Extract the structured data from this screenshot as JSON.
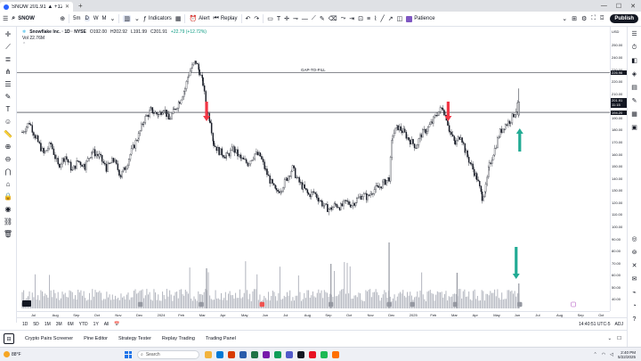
{
  "browser": {
    "tab_title": "SNOW 201.91 ▲ +12.73%",
    "new_tab": "+"
  },
  "toolbar": {
    "symbol": "SNOW",
    "interval_5m": "5m",
    "interval_d": "D",
    "interval_w": "W",
    "interval_m": "M",
    "indicators_label": "Indicators",
    "alert_label": "Alert",
    "replay_label": "Replay",
    "patience_label": "Patience",
    "publish_label": "Publish"
  },
  "legend": {
    "symbol_line": "Snowflake Inc. · 1D · NYSE",
    "o": "O192.00",
    "h": "H202.92",
    "l": "L191.99",
    "c": "C201.91",
    "change": "+22.79 (+12.72%)",
    "vol": "Vol 22.76M"
  },
  "annotations": {
    "gap_label": "GAP-TO-FILL"
  },
  "price_axis": {
    "currency": "USD",
    "ticks": [
      "260.00",
      "250.00",
      "240.00",
      "230.00",
      "220.00",
      "210.00",
      "200.00",
      "190.00",
      "180.00",
      "170.00",
      "160.00",
      "150.00",
      "140.00",
      "130.00",
      "120.00",
      "110.00",
      "100.00",
      "90.00",
      "80.00",
      "70.00",
      "60.00",
      "50.00",
      "40.00"
    ],
    "gap_price": "226.96",
    "current_price": "201.91",
    "current_time": "11:15",
    "support_price": "194.20"
  },
  "time_axis": {
    "labels": [
      "Jul",
      "Aug",
      "Sep",
      "Oct",
      "Nov",
      "Dec",
      "2024",
      "Feb",
      "Mar",
      "Apr",
      "May",
      "Jun",
      "Jul",
      "Aug",
      "Sep",
      "Oct",
      "Nov",
      "Dec",
      "2025",
      "Feb",
      "Mar",
      "Apr",
      "May",
      "Jun",
      "Jul",
      "Aug",
      "Sep",
      "Oct"
    ]
  },
  "rangebar": {
    "ranges": [
      "1D",
      "5D",
      "1M",
      "3M",
      "6M",
      "YTD",
      "1Y",
      "All"
    ],
    "clock": "14:40:51 UTC-5",
    "adj": "ADJ"
  },
  "panels": {
    "tabs": [
      "Crypto Pairs Screener",
      "Pine Editor",
      "Strategy Tester",
      "Replay Trading",
      "Trading Panel"
    ]
  },
  "taskbar": {
    "weather": "88°F",
    "search_placeholder": "Search",
    "time": "2:40 PM",
    "date": "5/22/2025"
  },
  "chart_data": {
    "type": "candlestick",
    "y_range": [
      30,
      265
    ],
    "levels": [
      {
        "name": "GAP-TO-FILL",
        "value": 226.96
      },
      {
        "name": "support",
        "value": 194.2
      }
    ],
    "series_close": [
      [
        0,
        178
      ],
      [
        8,
        186
      ],
      [
        16,
        172
      ],
      [
        24,
        160
      ],
      [
        32,
        168
      ],
      [
        40,
        150
      ],
      [
        48,
        158
      ],
      [
        56,
        146
      ],
      [
        62,
        154
      ],
      [
        70,
        150
      ],
      [
        78,
        162
      ],
      [
        86,
        158
      ],
      [
        94,
        148
      ],
      [
        102,
        155
      ],
      [
        110,
        142
      ],
      [
        116,
        150
      ],
      [
        122,
        162
      ],
      [
        130,
        175
      ],
      [
        136,
        188
      ],
      [
        144,
        196
      ],
      [
        152,
        192
      ],
      [
        158,
        198
      ],
      [
        164,
        188
      ],
      [
        170,
        196
      ],
      [
        176,
        204
      ],
      [
        182,
        214
      ],
      [
        186,
        226
      ],
      [
        190,
        232
      ],
      [
        194,
        236
      ],
      [
        198,
        228
      ],
      [
        202,
        218
      ],
      [
        206,
        196
      ],
      [
        210,
        188
      ],
      [
        214,
        168
      ],
      [
        220,
        162
      ],
      [
        228,
        158
      ],
      [
        236,
        164
      ],
      [
        244,
        156
      ],
      [
        252,
        152
      ],
      [
        260,
        160
      ],
      [
        266,
        158
      ],
      [
        272,
        146
      ],
      [
        278,
        136
      ],
      [
        284,
        128
      ],
      [
        290,
        132
      ],
      [
        296,
        140
      ],
      [
        302,
        148
      ],
      [
        308,
        138
      ],
      [
        314,
        132
      ],
      [
        320,
        126
      ],
      [
        326,
        128
      ],
      [
        332,
        122
      ],
      [
        338,
        116
      ],
      [
        344,
        114
      ],
      [
        350,
        118
      ],
      [
        356,
        116
      ],
      [
        362,
        120
      ],
      [
        368,
        118
      ],
      [
        374,
        122
      ],
      [
        380,
        126
      ],
      [
        386,
        124
      ],
      [
        392,
        130
      ],
      [
        398,
        132
      ],
      [
        404,
        136
      ],
      [
        410,
        140
      ],
      [
        414,
        176
      ],
      [
        420,
        182
      ],
      [
        426,
        178
      ],
      [
        432,
        172
      ],
      [
        440,
        166
      ],
      [
        446,
        176
      ],
      [
        452,
        180
      ],
      [
        458,
        186
      ],
      [
        464,
        194
      ],
      [
        470,
        198
      ],
      [
        474,
        190
      ],
      [
        478,
        178
      ],
      [
        484,
        168
      ],
      [
        490,
        176
      ],
      [
        496,
        160
      ],
      [
        502,
        150
      ],
      [
        508,
        140
      ],
      [
        514,
        124
      ],
      [
        518,
        132
      ],
      [
        522,
        150
      ],
      [
        528,
        164
      ],
      [
        534,
        178
      ],
      [
        540,
        184
      ],
      [
        546,
        188
      ],
      [
        552,
        196
      ],
      [
        555,
        202
      ]
    ],
    "volume_bars": "histogram"
  }
}
